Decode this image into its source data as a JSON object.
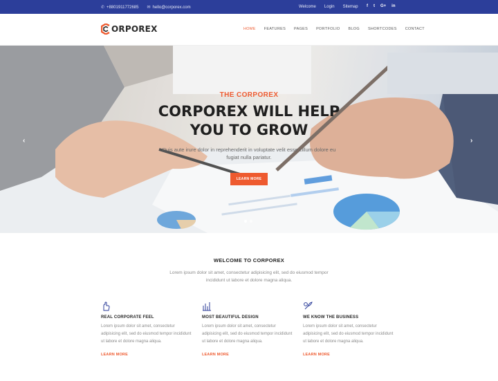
{
  "colors": {
    "topbar": "#2c3e9a",
    "accent": "#ee5a2f",
    "text": "#222222",
    "muted": "#8a8a8a"
  },
  "topbar": {
    "phone": "+8801911772685",
    "email": "hello@corporex.com",
    "links": [
      "Welcome",
      "Login",
      "Sitemap"
    ],
    "socials": [
      "facebook-icon",
      "twitter-icon",
      "google-plus-icon",
      "linkedin-icon"
    ],
    "social_glyphs": [
      "f",
      "t",
      "G+",
      "in"
    ]
  },
  "header": {
    "logo_text": "ORPOREX",
    "nav": [
      "HOME",
      "FEATURES",
      "PAGES",
      "PORTFOLIO",
      "BLOG",
      "SHORTCODES",
      "CONTACT"
    ],
    "active_nav": "HOME"
  },
  "hero": {
    "subtitle": "THE CORPOREX",
    "title": "CORPOREX WILL HELP YOU TO GROW",
    "text": "Duis aute irure dolor in reprehenderit in voluptate velit esse cillum dolore eu fugiat nulla pariatur.",
    "button": "LEARN MORE",
    "prev": "‹",
    "next": "›"
  },
  "welcome": {
    "title": "WELCOME TO CORPOREX",
    "text": "Lorem ipsum dolor sit amet, consectetur adipisicing elit, sed do eiusmod tempor incididunt ut labore et dolore magna aliqua."
  },
  "features": [
    {
      "icon": "hand-icon",
      "title": "REAL CORPORATE FEEL",
      "text": "Lorem ipsum dolor sit amet, consectetur adipisicing elit, sed do eiusmod tempor incididunt ut labore et dolore magna aliqua.",
      "link": "LEARN MORE"
    },
    {
      "icon": "design-icon",
      "title": "MOST BEAUTIFUL DESIGN",
      "text": "Lorem ipsum dolor sit amet, consectetur adipisicing elit, sed do eiusmod tempor incididunt ut labore et dolore magna aliqua.",
      "link": "LEARN MORE"
    },
    {
      "icon": "rocket-icon",
      "title": "WE KNOW THE BUSINESS",
      "text": "Lorem ipsum dolor sit amet, consectetur adipisicing elit, sed do eiusmod tempor incididunt ut labore et dolore magna aliqua.",
      "link": "LEARN MORE"
    }
  ]
}
